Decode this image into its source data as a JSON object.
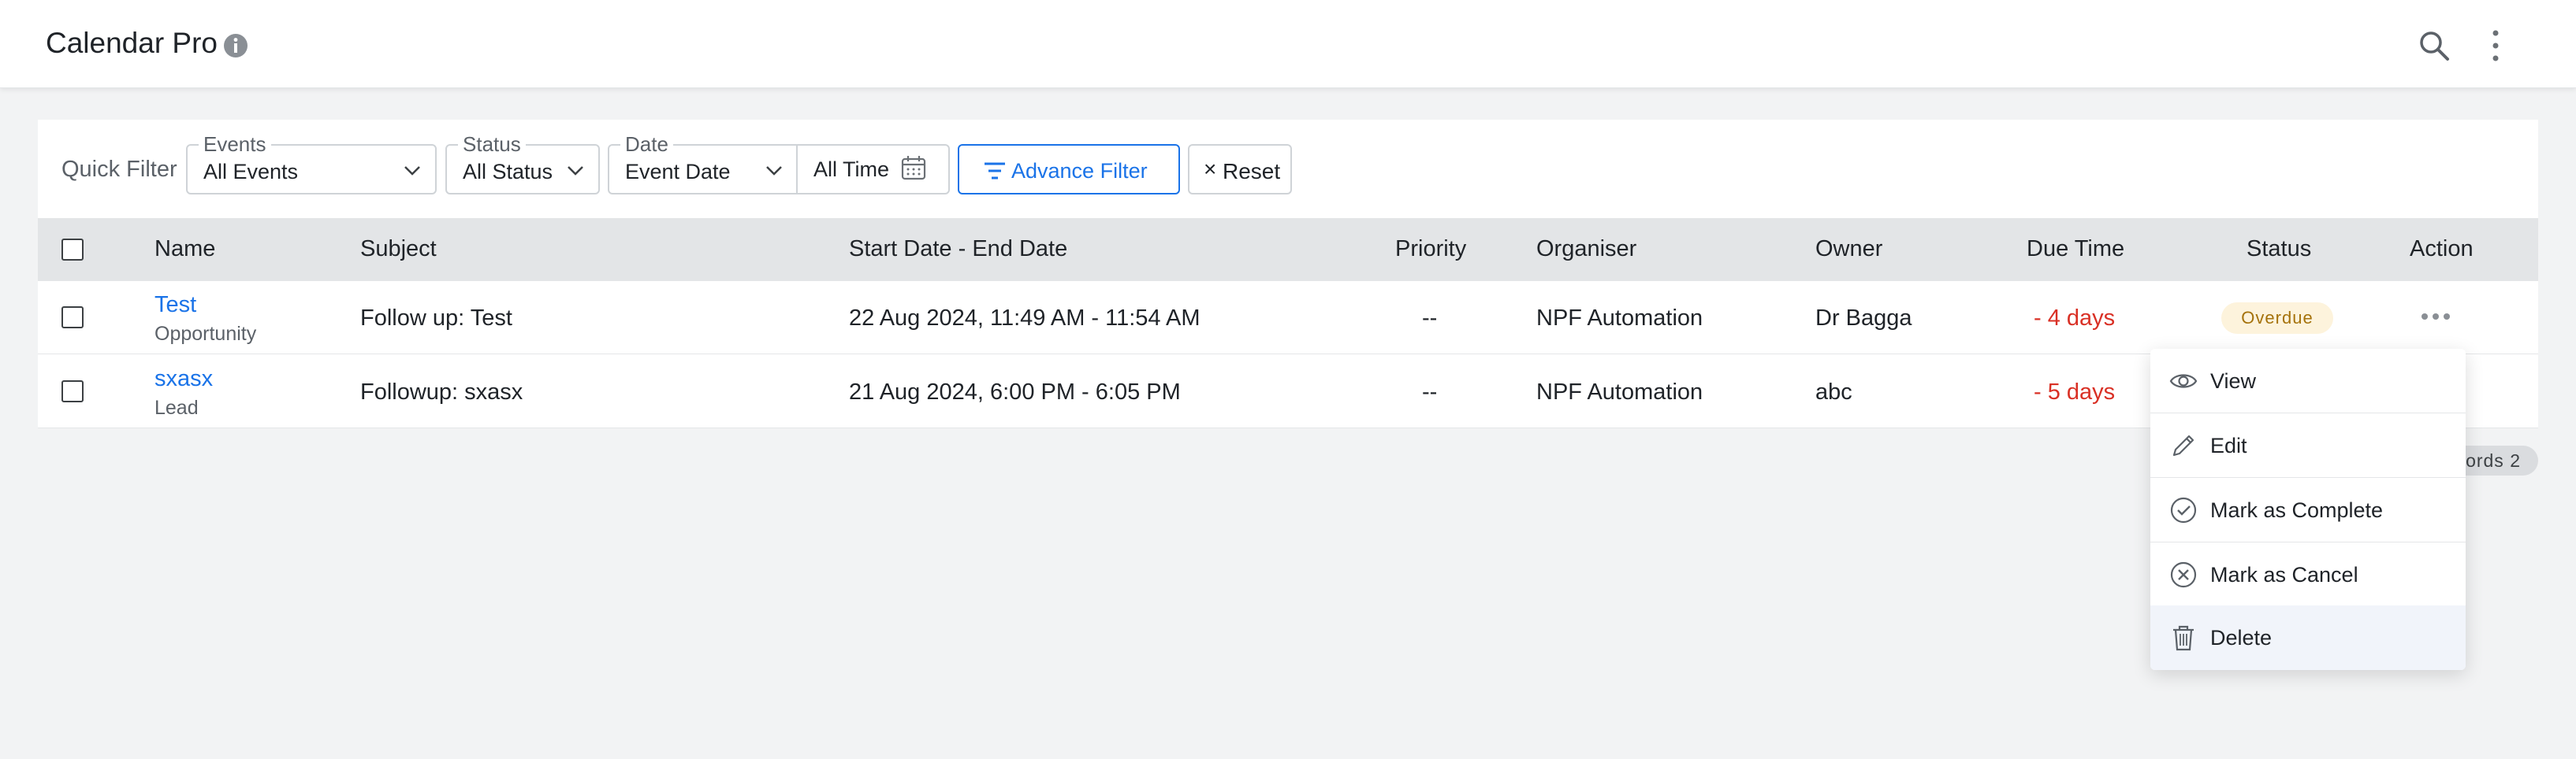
{
  "header": {
    "title": "Calendar Pro",
    "icons": [
      "info-icon",
      "search-icon",
      "more-vertical-icon"
    ]
  },
  "filters": {
    "quick_filter_label": "Quick Filter",
    "events": {
      "label": "Events",
      "value": "All Events"
    },
    "status": {
      "label": "Status",
      "value": "All Status"
    },
    "date": {
      "label": "Date",
      "value": "Event Date",
      "range": "All Time"
    },
    "advance_filter_label": "Advance Filter",
    "reset_label": "Reset"
  },
  "table": {
    "columns": [
      "Name",
      "Subject",
      "Start Date - End Date",
      "Priority",
      "Organiser",
      "Owner",
      "Due Time",
      "Status",
      "Action"
    ],
    "rows": [
      {
        "name": "Test",
        "type": "Opportunity",
        "subject": "Follow up: Test",
        "dates": "22 Aug 2024, 11:49 AM - 11:54 AM",
        "priority": "--",
        "organiser": "NPF Automation",
        "owner": "Dr Bagga",
        "due": "- 4 days",
        "status": "Overdue"
      },
      {
        "name": "sxasx",
        "type": "Lead",
        "subject": "Followup: sxasx",
        "dates": "21 Aug 2024, 6:00 PM - 6:05 PM",
        "priority": "--",
        "organiser": "NPF Automation",
        "owner": "abc",
        "due": "- 5 days",
        "status": ""
      }
    ],
    "records_label": "ords 2"
  },
  "action_menu": {
    "items": [
      "View",
      "Edit",
      "Mark as Complete",
      "Mark as Cancel",
      "Delete"
    ]
  },
  "colors": {
    "accent": "#1a73e8",
    "overdue_text": "#d93025",
    "badge_bg": "#fdf3dc",
    "badge_text": "#a5720b"
  }
}
